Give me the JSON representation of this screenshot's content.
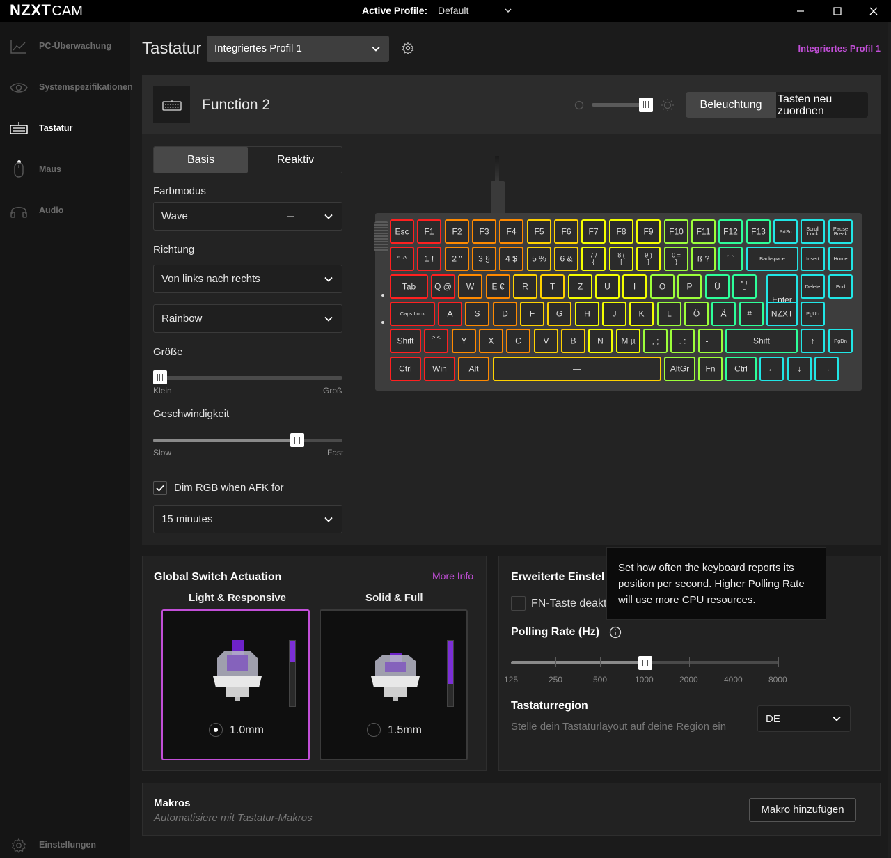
{
  "titlebar": {
    "logo_main": "NZXT",
    "logo_sub": "CAM",
    "active_profile_label": "Active Profile:",
    "active_profile_value": "Default"
  },
  "sidebar": {
    "items": [
      {
        "label": "PC-Überwachung",
        "icon": "chart-line-icon"
      },
      {
        "label": "Systemspezifikationen",
        "icon": "eye-icon"
      },
      {
        "label": "Tastatur",
        "icon": "keyboard-icon"
      },
      {
        "label": "Maus",
        "icon": "mouse-icon"
      },
      {
        "label": "Audio",
        "icon": "headset-icon"
      }
    ],
    "active_index": 2,
    "settings_label": "Einstellungen"
  },
  "header": {
    "page_title": "Tastatur",
    "profile_select": "Integriertes Profil 1",
    "profile_link": "Integriertes Profil 1"
  },
  "device": {
    "name": "Function 2",
    "brightness": 0.93,
    "lighting_button": "Beleuchtung",
    "remap_button": "Tasten neu\nzuordnen"
  },
  "lighting": {
    "tabs": [
      "Basis",
      "Reaktiv"
    ],
    "active_tab": 0,
    "color_mode_label": "Farbmodus",
    "color_mode_value": "Wave",
    "direction_label": "Richtung",
    "direction_value": "Von links nach rechts",
    "palette_value": "Rainbow",
    "size_label": "Größe",
    "size_value": 0.0,
    "size_min": "Klein",
    "size_max": "Groß",
    "speed_label": "Geschwindigkeit",
    "speed_value": 0.78,
    "speed_min": "Slow",
    "speed_max": "Fast",
    "dim_label": "Dim RGB when AFK for",
    "dim_checked": true,
    "dim_value": "15 minutes"
  },
  "keyboard": {
    "rows": [
      [
        "Esc",
        "F1",
        "F2",
        "F3",
        "F4",
        "F5",
        "F6",
        "F7",
        "F8",
        "F9",
        "F10",
        "F11",
        "F12",
        "F13",
        "PrtSc",
        "Scroll\nLock",
        "Pause\nBreak"
      ],
      [
        "° ^",
        "1 !",
        "2 \"",
        "3 §",
        "4 $",
        "5 %",
        "6 &",
        "7 /\n{",
        "8 (\n[",
        "9 )\n]",
        "0 =\n}",
        "ß ?",
        "´ `",
        "Backspace",
        "Insert",
        "Home"
      ],
      [
        "Tab",
        "Q @",
        "W",
        "E €",
        "R",
        "T",
        "Z",
        "U",
        "I",
        "O",
        "P",
        "Ü",
        "* +\n~",
        "Enter",
        "Delete",
        "End"
      ],
      [
        "Caps Lock",
        "A",
        "S",
        "D",
        "F",
        "G",
        "H",
        "J",
        "K",
        "L",
        "Ö",
        "Ä",
        "# '",
        "NZXT",
        "PgUp"
      ],
      [
        "Shift",
        "> <\n|",
        "Y",
        "X",
        "C",
        "V",
        "B",
        "N",
        "M µ",
        ", ;",
        ". :",
        "- _",
        "Shift",
        "↑",
        "PgDn"
      ],
      [
        "Ctrl",
        "Win",
        "Alt",
        "—",
        "AltGr",
        "Fn",
        "Ctrl",
        "←",
        "↓",
        "→"
      ]
    ]
  },
  "actuation": {
    "title": "Global Switch Actuation",
    "more_info": "More Info",
    "options": [
      {
        "caption": "Light & Responsive",
        "value": "1.0mm",
        "selected": true,
        "depth": 0.33
      },
      {
        "caption": "Solid & Full",
        "value": "1.5mm",
        "selected": false,
        "depth": 0.66
      }
    ]
  },
  "advanced": {
    "title": "Erweiterte Einstel",
    "fn_label": "FN-Taste deakt",
    "fn_checked": false,
    "tooltip": "Set how often the keyboard reports its position per second. Higher Polling Rate will use more CPU resources.",
    "polling_title": "Polling Rate (Hz)",
    "polling_values": [
      "125",
      "250",
      "500",
      "1000",
      "2000",
      "4000",
      "8000"
    ],
    "polling_selected": "1000",
    "region_title": "Tastaturregion",
    "region_desc": "Stelle dein Tastaturlayout auf deine Region ein",
    "region_value": "DE"
  },
  "macros": {
    "title": "Makros",
    "subtitle": "Automatisiere mit Tastatur-Makros",
    "add_button": "Makro hinzufügen"
  }
}
